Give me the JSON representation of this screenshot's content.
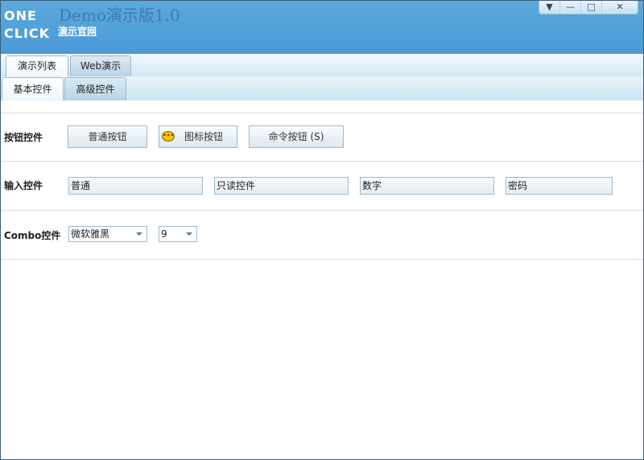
{
  "header": {
    "logo": [
      "ONE",
      "CLICK"
    ],
    "title": "Demo演示版1.0",
    "site_link": "演示官网"
  },
  "window_controls": [
    "▼",
    "—",
    "□",
    "✕"
  ],
  "tabs_top": [
    "演示列表",
    "Web演示"
  ],
  "tabs_sub": [
    "基本控件",
    "高级控件"
  ],
  "rows": {
    "buttons": {
      "label": "按钮控件",
      "normal": "普通按钮",
      "icon": "图标按钮",
      "command": "命令按钮 (S)"
    },
    "inputs": {
      "label": "输入控件",
      "values": [
        "普通",
        "只读控件",
        "数字",
        "密码"
      ]
    },
    "combos": {
      "label": "Combo控件",
      "font": "微软雅黑",
      "size": "9"
    }
  }
}
